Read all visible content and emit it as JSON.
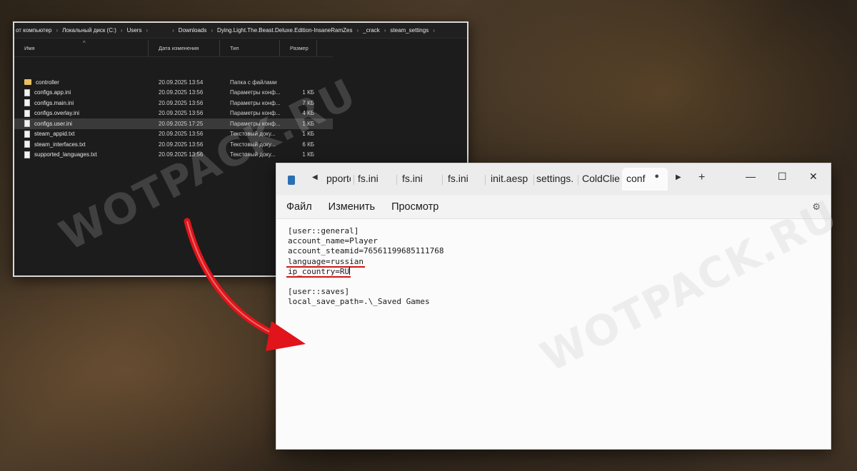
{
  "explorer": {
    "breadcrumbs": [
      "от компьютер",
      "Локальный диск (C:)",
      "Users",
      "",
      "Downloads",
      "Dying.Light.The.Beast.Deluxe.Edition-InsaneRamZes",
      "_crack",
      "steam_settings"
    ],
    "columns": {
      "name": "Имя",
      "date": "Дата изменения",
      "type": "Тип",
      "size": "Размер"
    },
    "files": [
      {
        "icon": "folder-icon",
        "name": "controller",
        "date": "20.09.2025 13:54",
        "type": "Папка с файлами",
        "size": ""
      },
      {
        "icon": "file-icon",
        "name": "configs.app.ini",
        "date": "20.09.2025 13:56",
        "type": "Параметры конф...",
        "size": "1 КБ"
      },
      {
        "icon": "file-icon",
        "name": "configs.main.ini",
        "date": "20.09.2025 13:56",
        "type": "Параметры конф...",
        "size": "7 КБ"
      },
      {
        "icon": "file-icon",
        "name": "configs.overlay.ini",
        "date": "20.09.2025 13:56",
        "type": "Параметры конф...",
        "size": "4 КБ"
      },
      {
        "icon": "file-icon",
        "name": "configs.user.ini",
        "date": "20.09.2025 17:25",
        "type": "Параметры конф...",
        "size": "1 КБ",
        "selected": true
      },
      {
        "icon": "file-icon",
        "name": "steam_appid.txt",
        "date": "20.09.2025 13:56",
        "type": "Текстовый доку...",
        "size": "1 КБ"
      },
      {
        "icon": "file-icon",
        "name": "steam_interfaces.txt",
        "date": "20.09.2025 13:56",
        "type": "Текстовый доку...",
        "size": "6 КБ"
      },
      {
        "icon": "file-icon",
        "name": "supported_languages.txt",
        "date": "20.09.2025 13:56",
        "type": "Текстовый доку...",
        "size": "1 КБ"
      }
    ]
  },
  "notepad": {
    "tabs": [
      "pporte",
      "fs.ini",
      "fs.ini",
      "fs.ini",
      "init.aesp",
      "settings.",
      "ColdClie",
      "conf"
    ],
    "active_tab": "conf",
    "unsaved_marker": "●",
    "new_tab": "+",
    "window_controls": {
      "minimize": "—",
      "maximize": "☐",
      "close": "✕"
    },
    "menu": {
      "file": "Файл",
      "edit": "Изменить",
      "view": "Просмотр"
    },
    "content_lines": [
      "[user::general]",
      "account_name=Player",
      "account_steamid=76561199685111768",
      "language=russian",
      "ip_country=RU",
      "",
      "[user::saves]",
      "local_save_path=.\\_Saved Games"
    ],
    "highlighted_lines": [
      3,
      4
    ]
  },
  "watermark": "WOTPACK.RU",
  "colors": {
    "highlight_red": "#d01616",
    "arrow_red": "#e0141a",
    "folder_yellow": "#e8c062"
  }
}
